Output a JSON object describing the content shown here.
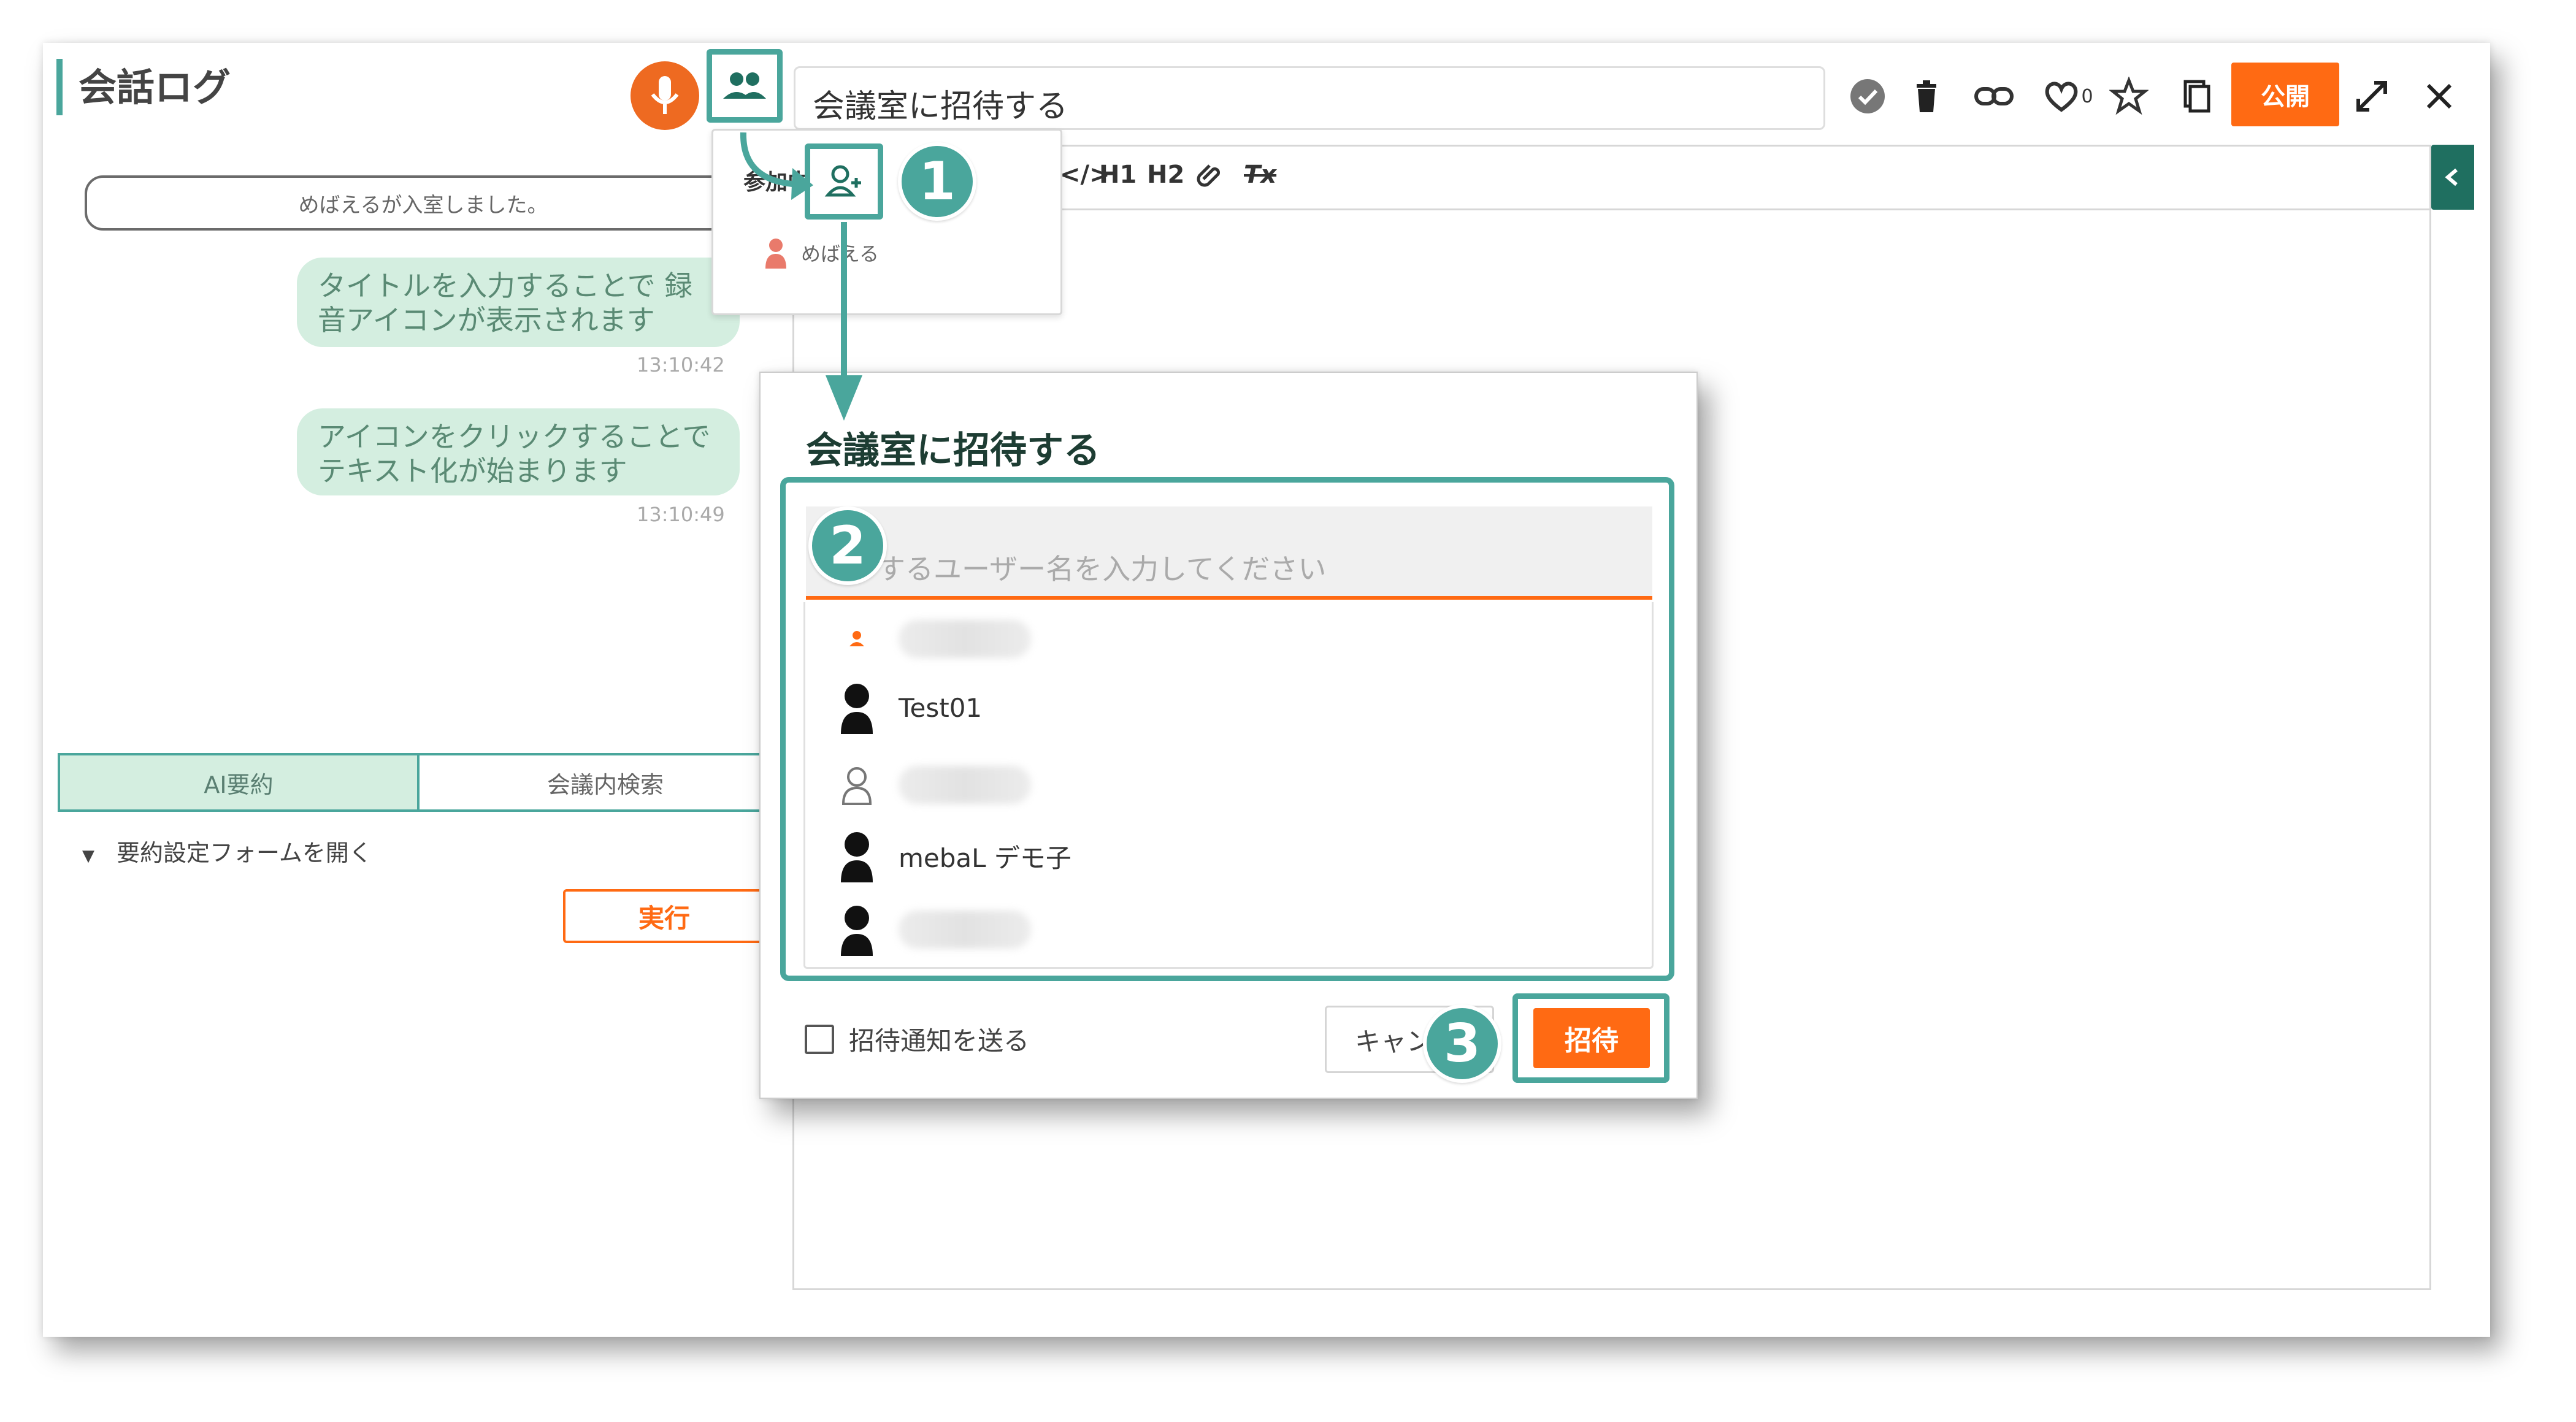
{
  "header": {
    "title": "会話ログ",
    "meeting_title": "会議室に招待する",
    "like_count": "0",
    "publish_label": "公開"
  },
  "icons": {
    "mic": "mic-icon",
    "participants": "people-icon",
    "check": "check-circle-icon",
    "delete": "trash-icon",
    "link": "link-icon",
    "like": "heart-icon",
    "favorite": "star-icon",
    "copy": "copy-icon",
    "expand": "expand-icon",
    "close": "close-icon",
    "add_user": "add-user-icon",
    "collapse": "chevron-left-icon"
  },
  "editor_toolbar": {
    "code": "</>",
    "h1": "H1",
    "h2": "H2",
    "clear_format": "Tx"
  },
  "chat": {
    "system_message": "めばえるが入室しました。",
    "messages": [
      {
        "text": "タイトルを入力することで 録音アイコンが表示されます",
        "time": "13:10:42"
      },
      {
        "text": "アイコンをクリックすることでテキスト化が始まります",
        "time": "13:10:49"
      }
    ]
  },
  "tabs": [
    {
      "label": "AI要約",
      "active": true
    },
    {
      "label": "会議内検索",
      "active": false
    }
  ],
  "summary": {
    "toggle_label": "要約設定フォームを開く",
    "run_label": "実行"
  },
  "participants_dropdown": {
    "label": "参加中",
    "users": [
      {
        "name": "めばえる"
      }
    ]
  },
  "invite_dialog": {
    "title": "会議室に招待する",
    "search_placeholder": "するユーザー名を入力してください",
    "users": [
      {
        "name": "",
        "blurred": true,
        "avatar": "orange-person-icon"
      },
      {
        "name": "Test01",
        "blurred": false,
        "avatar": "person-silhouette-icon"
      },
      {
        "name": "",
        "blurred": true,
        "avatar": "person-outline-icon"
      },
      {
        "name": "mebaL デモ子",
        "blurred": false,
        "avatar": "person-silhouette-icon"
      },
      {
        "name": "",
        "blurred": true,
        "avatar": "person-silhouette-icon"
      }
    ],
    "notify_label": "招待通知を送る",
    "cancel_label": "キャンセル",
    "invite_label": "招待"
  },
  "steps": [
    "1",
    "2",
    "3"
  ],
  "colors": {
    "teal": "#4aa69c",
    "orange": "#ff6a13",
    "bubble": "#d4eee0",
    "dark_green": "#1f6f60"
  }
}
